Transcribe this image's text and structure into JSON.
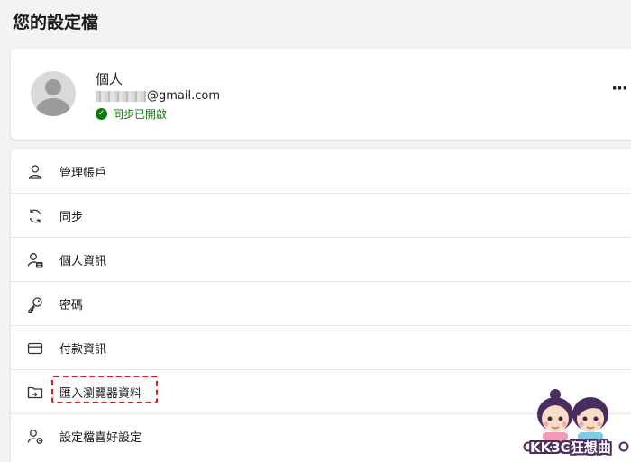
{
  "page": {
    "title": "您的設定檔"
  },
  "profile": {
    "name": "個人",
    "email_domain": "@gmail.com",
    "sync_status": "同步已開啟",
    "more_icon": "more-horizontal-icon"
  },
  "menu": {
    "items": [
      {
        "label": "管理帳戶",
        "icon": "person-icon"
      },
      {
        "label": "同步",
        "icon": "sync-icon"
      },
      {
        "label": "個人資訊",
        "icon": "personal-info-icon"
      },
      {
        "label": "密碼",
        "icon": "key-icon"
      },
      {
        "label": "付款資訊",
        "icon": "credit-card-icon"
      },
      {
        "label": "匯入瀏覽器資料",
        "icon": "import-folder-icon"
      },
      {
        "label": "設定檔喜好設定",
        "icon": "profile-settings-icon"
      }
    ]
  },
  "watermark": {
    "text": "KK3C狂想曲"
  },
  "colors": {
    "background": "#f3f3f3",
    "card": "#ffffff",
    "sync_green": "#0e7a0d",
    "highlight_red": "#e01a1a"
  }
}
